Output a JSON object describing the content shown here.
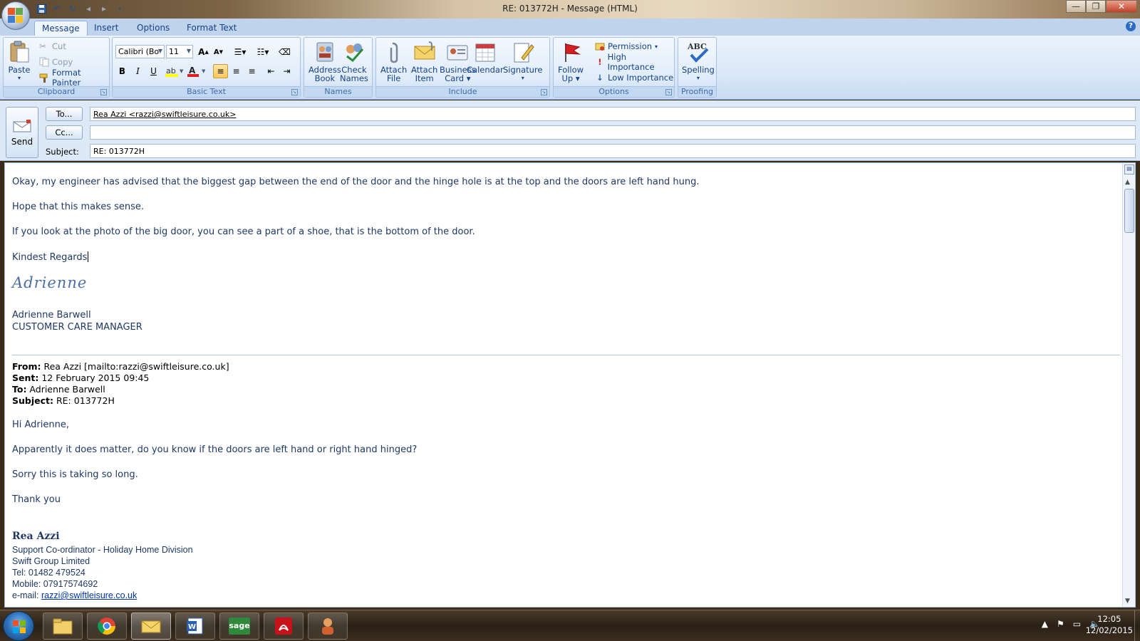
{
  "window": {
    "title": "RE: 013772H - Message (HTML)",
    "min_label": "—",
    "max_label": "❐",
    "close_label": "✕"
  },
  "ribbon": {
    "tabs": [
      {
        "label": "Message",
        "active": true
      },
      {
        "label": "Insert",
        "active": false
      },
      {
        "label": "Options",
        "active": false
      },
      {
        "label": "Format Text",
        "active": false
      }
    ],
    "clipboard": {
      "group_label": "Clipboard",
      "paste": "Paste",
      "cut": "Cut",
      "copy": "Copy",
      "format_painter": "Format Painter"
    },
    "basic_text": {
      "group_label": "Basic Text",
      "font_name": "Calibri (Bo",
      "font_size": "11",
      "bold": "B",
      "italic": "I",
      "underline": "U"
    },
    "names": {
      "group_label": "Names",
      "address_book_1": "Address",
      "address_book_2": "Book",
      "check_names_1": "Check",
      "check_names_2": "Names"
    },
    "include": {
      "group_label": "Include",
      "attach_file_1": "Attach",
      "attach_file_2": "File",
      "attach_item_1": "Attach",
      "attach_item_2": "Item",
      "business_card_1": "Business",
      "business_card_2": "Card",
      "calendar": "Calendar",
      "signature": "Signature"
    },
    "options": {
      "group_label": "Options",
      "follow_up_1": "Follow",
      "follow_up_2": "Up",
      "permission": "Permission",
      "high_importance": "High Importance",
      "low_importance": "Low Importance"
    },
    "proofing": {
      "group_label": "Proofing",
      "spelling": "Spelling",
      "abc": "ABC"
    }
  },
  "header": {
    "send": "Send",
    "to_button": "To...",
    "cc_button": "Cc...",
    "subject_label": "Subject:",
    "to_value": "Rea Azzi <razzi@swiftleisure.co.uk>",
    "cc_value": "",
    "subject_value": "RE: 013772H"
  },
  "body": {
    "line1": "Okay,  my engineer has advised that the biggest gap between the end of the door and the hinge hole is at the top and the doors are left hand hung.",
    "line2": "Hope that this makes sense.",
    "line3": "If you look at the photo of the big door, you can see a part of a  shoe, that is the bottom of the door.",
    "closing": "Kindest Regards",
    "signature_script": "Adrienne",
    "sender_name": "Adrienne Barwell",
    "sender_title": "CUSTOMER CARE MANAGER",
    "quoted": {
      "from_label": "From:",
      "from_value": " Rea Azzi [mailto:razzi@swiftleisure.co.uk]",
      "sent_label": "Sent:",
      "sent_value": " 12 February 2015 09:45",
      "to_label": "To:",
      "to_value": " Adrienne Barwell",
      "subject_label": "Subject:",
      "subject_value": " RE: 013772H",
      "greeting": "Hi Adrienne,",
      "q1": "Apparently it does matter, do you know if the doors are left hand or right hand hinged?",
      "q2": "Sorry this is taking so long.",
      "q3": "Thank you",
      "rea_name": "Rea Azzi",
      "rea_title": "Support Co-ordinator - Holiday Home Division",
      "company": "Swift Group Limited",
      "tel": "Tel: 01482 479524",
      "mobile": "Mobile: 07917574692",
      "email_label": "e-mail: ",
      "email_value": "razzi@swiftleisure.co.uk"
    }
  },
  "taskbar": {
    "time": "12:05",
    "date": "12/02/2015",
    "sage_label": "sage"
  }
}
